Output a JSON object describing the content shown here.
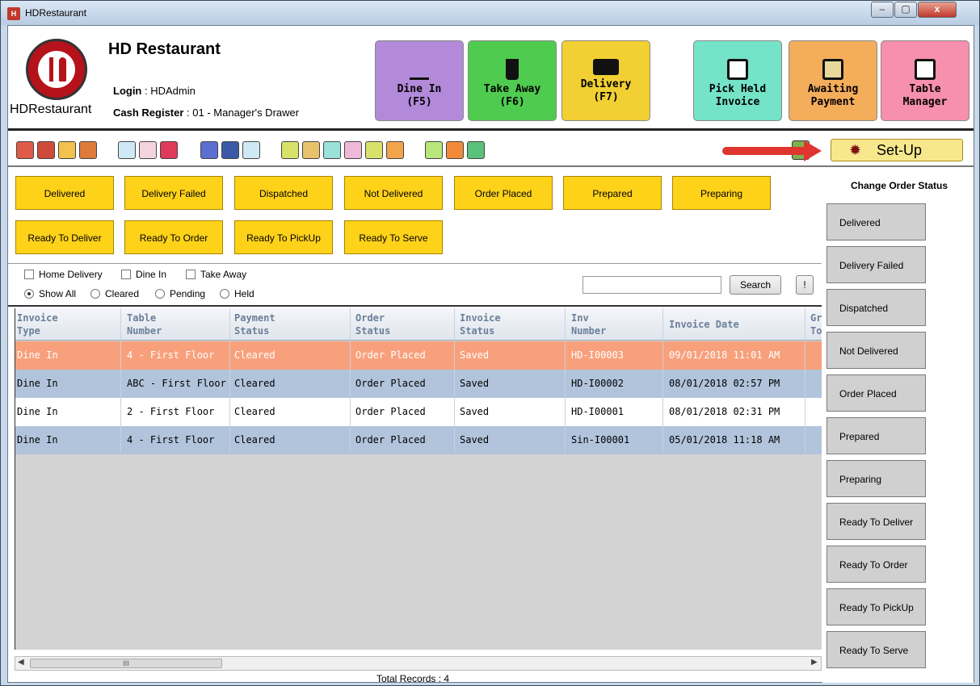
{
  "window": {
    "title": "HDRestaurant",
    "minimize": "–",
    "maximize": "▢",
    "close": "x"
  },
  "header": {
    "logo_text": "HDRestaurant",
    "company": "HD Restaurant",
    "login_label": "Login",
    "login_value": ": HDAdmin",
    "cash_label": "Cash Register",
    "cash_value": ": 01 - Manager's Drawer"
  },
  "big_buttons": [
    {
      "line1": "Dine In",
      "line2": "(F5)",
      "color": "#b28ad9"
    },
    {
      "line1": "Take Away",
      "line2": "(F6)",
      "color": "#4fcb4f"
    },
    {
      "line1": "Delivery",
      "line2": "(F7)",
      "color": "#f2d033"
    },
    {
      "line1": "Pick Held",
      "line2": "Invoice",
      "color": "#74e3c7"
    },
    {
      "line1": "Awaiting",
      "line2": "Payment",
      "color": "#f4ad5b"
    },
    {
      "line1": "Table",
      "line2": "Manager",
      "color": "#f78fae"
    }
  ],
  "toolbar": {
    "setup_label": "Set-Up"
  },
  "status_buttons": [
    "Delivered",
    "Delivery Failed",
    "Dispatched",
    "Not Delivered",
    "Order Placed",
    "Prepared",
    "Preparing",
    "Ready To Deliver",
    "Ready To Order",
    "Ready To PickUp",
    "Ready To Serve"
  ],
  "filters": {
    "home_delivery": "Home Delivery",
    "dine_in": "Dine In",
    "take_away": "Take Away",
    "show_all": "Show All",
    "cleared": "Cleared",
    "pending": "Pending",
    "held": "Held",
    "search_value": "",
    "search_button": "Search",
    "excl_button": "!"
  },
  "grid": {
    "headers": [
      {
        "l1": "Invoice",
        "l2": "Type"
      },
      {
        "l1": "Table",
        "l2": "Number"
      },
      {
        "l1": "Payment",
        "l2": "Status"
      },
      {
        "l1": "Order",
        "l2": "Status"
      },
      {
        "l1": "Invoice",
        "l2": "Status"
      },
      {
        "l1": "Inv",
        "l2": "Number"
      },
      {
        "l1": "Invoice Date",
        "l2": ""
      },
      {
        "l1": "Gra",
        "l2": "Tot"
      }
    ],
    "rows": [
      [
        "Dine In",
        "4 - First Floor",
        "Cleared",
        "Order Placed",
        "Saved",
        "HD-I00003",
        "09/01/2018 11:01 AM"
      ],
      [
        "Dine In",
        "ABC - First Floor",
        "Cleared",
        "Order Placed",
        "Saved",
        "HD-I00002",
        "08/01/2018 02:57 PM"
      ],
      [
        "Dine In",
        "2 - First Floor",
        "Cleared",
        "Order Placed",
        "Saved",
        "HD-I00001",
        "08/01/2018 02:31 PM"
      ],
      [
        "Dine In",
        "4 - First Floor",
        "Cleared",
        "Order Placed",
        "Saved",
        "Sin-I00001",
        "05/01/2018 11:18 AM"
      ]
    ],
    "scroll_thumb": "III"
  },
  "total_records": "Total Records : 4",
  "side_panel": {
    "title": "Change Order Status",
    "items": [
      "Delivered",
      "Delivery Failed",
      "Dispatched",
      "Not Delivered",
      "Order Placed",
      "Prepared",
      "Preparing",
      "Ready To Deliver",
      "Ready To Order",
      "Ready To PickUp",
      "Ready To Serve"
    ]
  },
  "colors": {
    "status_button": "#ffd21a",
    "selected_row": "#f8a07c",
    "alt_row": "#b1c4dc",
    "setup": "#f7e88d",
    "arrow": "#e0352f"
  }
}
